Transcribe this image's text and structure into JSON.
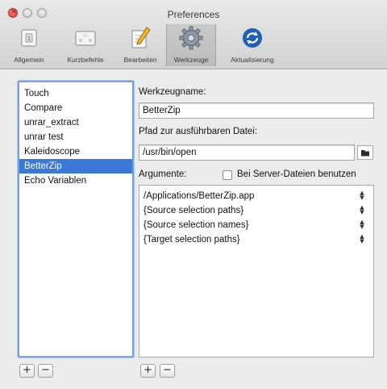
{
  "window": {
    "title": "Preferences"
  },
  "toolbar": {
    "items": [
      {
        "label": "Allgemein",
        "icon": "general-switch-icon"
      },
      {
        "label": "Kurzbefehle",
        "icon": "keyboard-shortcuts-icon"
      },
      {
        "label": "Bearbeiten",
        "icon": "edit-pencil-icon"
      },
      {
        "label": "Werkzeuge",
        "icon": "gear-icon",
        "selected": true
      },
      {
        "label": "Aktualisierung",
        "icon": "update-sync-icon"
      }
    ]
  },
  "tools": {
    "items": [
      "Touch",
      "Compare",
      "unrar_extract",
      "unrar test",
      "Kaleidoscope",
      "BetterZip",
      "Echo Variablen"
    ],
    "selected": "BetterZip"
  },
  "form": {
    "name_label": "Werkzeugname:",
    "name_value": "BetterZip",
    "path_label": "Pfad zur ausführbaren Datei:",
    "path_value": "/usr/bin/open",
    "args_label": "Argumente:",
    "server_files_label": "Bei Server-Dateien benutzen",
    "server_files_checked": false,
    "arguments": [
      "/Applications/BetterZip.app",
      "{Source selection paths}",
      "{Source selection names}",
      "{Target selection paths}"
    ]
  },
  "buttons": {
    "add": "+",
    "remove": "−"
  }
}
